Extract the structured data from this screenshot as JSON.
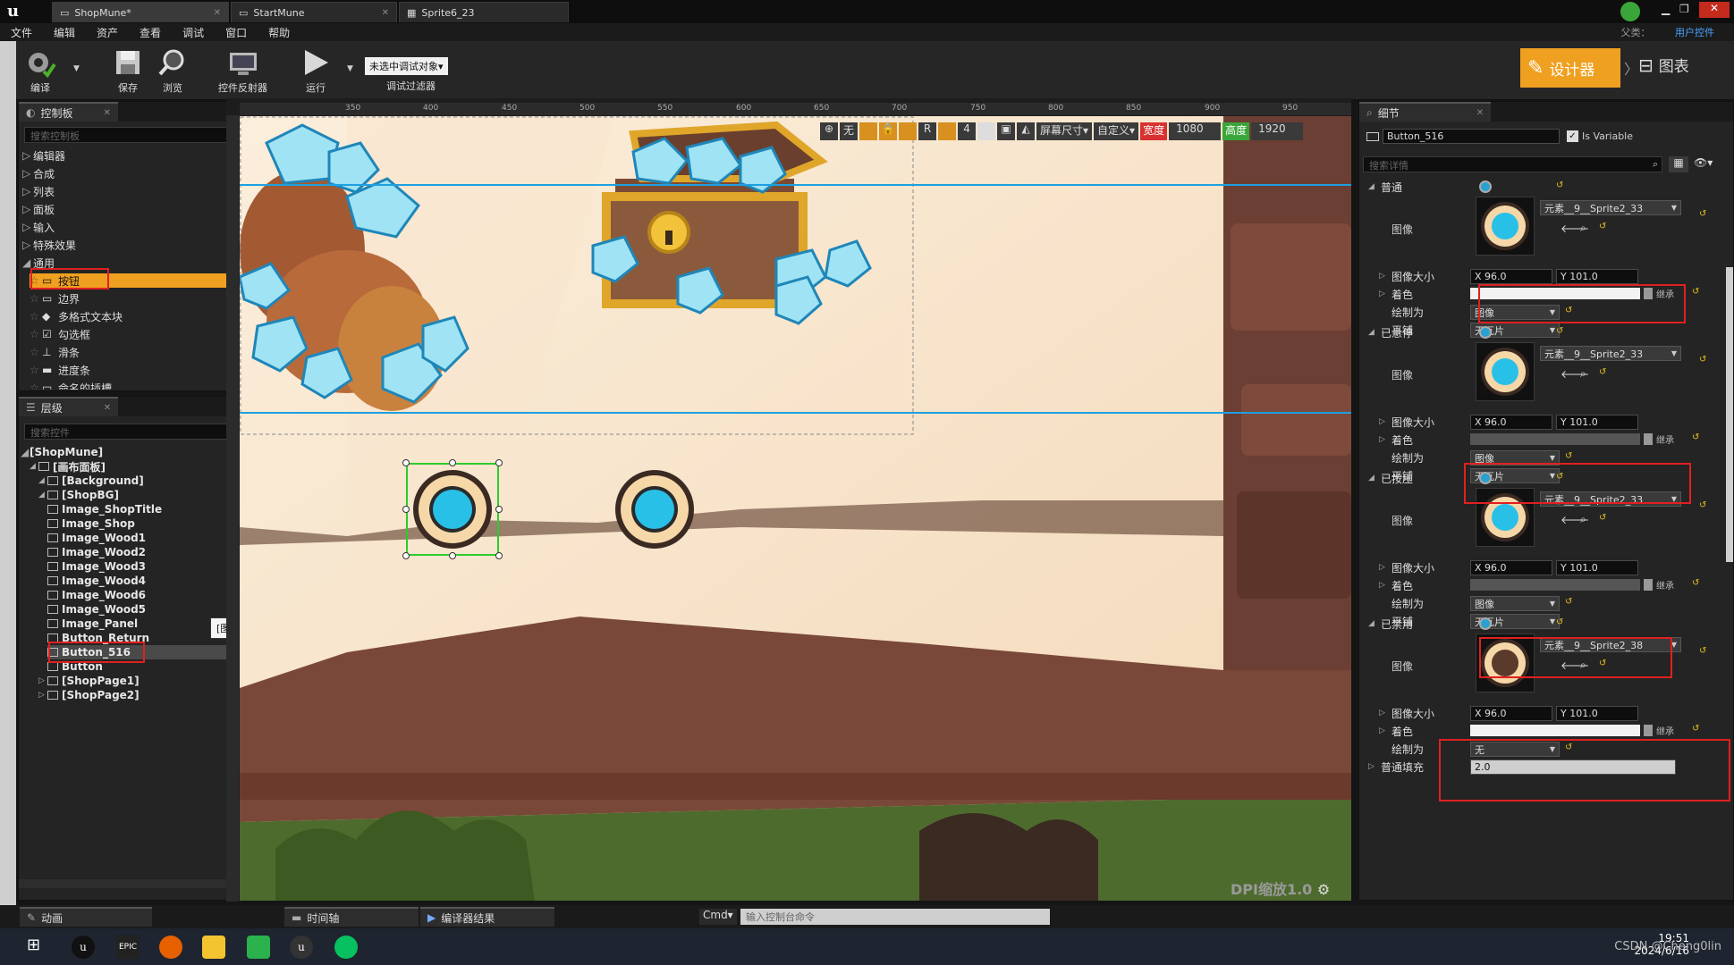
{
  "tabs": [
    "ShopMune*",
    "StartMune",
    "Sprite6_23"
  ],
  "title_right": {
    "parent_label": "父类：",
    "parent_value": "用户控件"
  },
  "menu": [
    "文件",
    "编辑",
    "资产",
    "查看",
    "调试",
    "窗口",
    "帮助"
  ],
  "toolbar": {
    "compile": "编译",
    "save": "保存",
    "browse": "浏览",
    "reflector": "控件反射器",
    "run": "运行",
    "debug_select": "未选中调试对象▾",
    "debug_filter": "调试过滤器",
    "designer": "设计器",
    "graph": "图表"
  },
  "palette": {
    "tab": "控制板",
    "search_placeholder": "搜索控制板",
    "categories": [
      "编辑器",
      "合成",
      "列表",
      "面板",
      "输入",
      "特殊效果",
      "通用"
    ],
    "common_items": [
      "按钮",
      "边界",
      "多格式文本块",
      "勾选框",
      "滑条",
      "进度条",
      "命名的插槽"
    ]
  },
  "hierarchy": {
    "tab": "层级",
    "search_placeholder": "搜索控件",
    "root": "[ShopMune]",
    "items": [
      {
        "label": "[画布面板]",
        "indent": 1
      },
      {
        "label": "[Background]",
        "indent": 2
      },
      {
        "label": "[ShopBG]",
        "indent": 2
      },
      {
        "label": "Image_ShopTitle",
        "indent": 3
      },
      {
        "label": "Image_Shop",
        "indent": 3
      },
      {
        "label": "Image_Wood1",
        "indent": 3
      },
      {
        "label": "Image_Wood2",
        "indent": 3
      },
      {
        "label": "Image_Wood3",
        "indent": 3
      },
      {
        "label": "Image_Wood4",
        "indent": 3
      },
      {
        "label": "Image_Wood6",
        "indent": 3
      },
      {
        "label": "Image_Wood5",
        "indent": 3
      },
      {
        "label": "Image_Panel",
        "indent": 3
      },
      {
        "label": "Button_Return",
        "indent": 3
      },
      {
        "label": "Button_516",
        "indent": 3
      },
      {
        "label": "Button",
        "indent": 3
      },
      {
        "label": "[ShopPage1]",
        "indent": 2
      },
      {
        "label": "[ShopPage2]",
        "indent": 2
      }
    ],
    "tooltip": "[图像]"
  },
  "canvas": {
    "ruler": [
      "350",
      "400",
      "450",
      "500",
      "550",
      "600",
      "650",
      "700",
      "750",
      "800",
      "850",
      "900",
      "950"
    ],
    "toolbar": {
      "none": "无",
      "r": "R",
      "four": "4",
      "screen_size": "屏幕尺寸▾",
      "custom": "自定义▾",
      "width_label": "宽度",
      "width": "1080",
      "height_label": "高度",
      "height": "1920"
    },
    "dpi": "DPI缩放1.0"
  },
  "details": {
    "tab": "细节",
    "name": "Button_516",
    "is_variable": "Is Variable",
    "search_placeholder": "搜索详情",
    "sections": [
      {
        "title": "普通",
        "sprite": "元素__9__Sprite2_33",
        "tint_dark": false,
        "draw_as": "图像",
        "tiling": "无瓦片"
      },
      {
        "title": "已悬停",
        "sprite": "元素__9__Sprite2_33",
        "tint_dark": true,
        "draw_as": "图像",
        "tiling": "无瓦片"
      },
      {
        "title": "已按压",
        "sprite": "元素__9__Sprite2_33",
        "tint_dark": true,
        "draw_as": "图像",
        "tiling": "无瓦片"
      },
      {
        "title": "已禁用",
        "sprite": "元素__9__Sprite2_38",
        "tint_dark": false,
        "draw_as": "无",
        "tiling": ""
      }
    ],
    "labels": {
      "image": "图像",
      "image_size": "图像大小",
      "tint": "着色",
      "draw_as": "绘制为",
      "tiling": "平铺",
      "inherit": "继承"
    },
    "size_x": "X  96.0",
    "size_y": "Y  101.0",
    "padding_label": "普通填充",
    "padding_value": "2.0"
  },
  "bottom": {
    "anim": "动画",
    "timeline": "时间轴",
    "compile_results": "编译器结果",
    "cmd": "Cmd▾",
    "console_placeholder": "输入控制台命令"
  },
  "taskbar": {
    "time": "19:51",
    "date": "2024/6/16",
    "watermark": "CSDN @Cheng0lin"
  },
  "colors": {
    "accent": "#f0a020",
    "selection_red": "#e02020",
    "cyan_line": "#1ea0e0"
  }
}
